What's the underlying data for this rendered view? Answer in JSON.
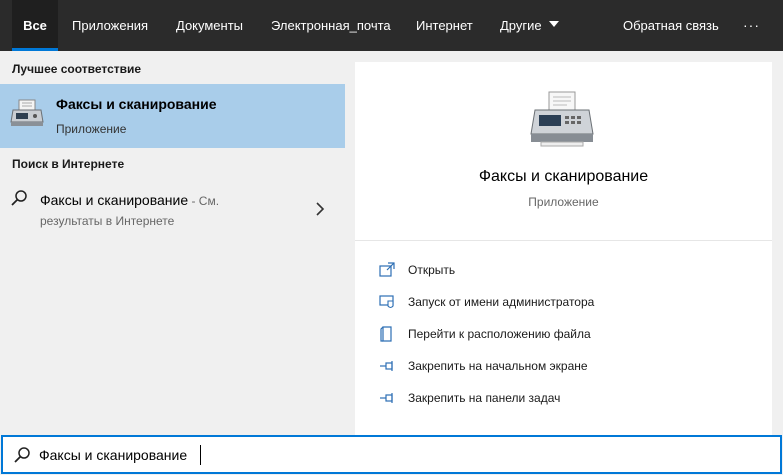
{
  "tabs": [
    {
      "label": "Все",
      "active": true
    },
    {
      "label": "Приложения"
    },
    {
      "label": "Документы"
    },
    {
      "label": "Электронная_почта"
    },
    {
      "label": "Интернет"
    },
    {
      "label": "Другие"
    }
  ],
  "header": {
    "feedback": "Обратная связь",
    "more": "···"
  },
  "left": {
    "best_match_title": "Лучшее соответствие",
    "best_match": {
      "title": "Факсы и сканирование",
      "subtitle": "Приложение",
      "icon": "fax-scanner-icon"
    },
    "web_title": "Поиск в Интернете",
    "web_result": {
      "title": "Факсы и сканирование",
      "suffix": " - См.",
      "subtitle": "результаты в Интернете",
      "icon": "search-icon"
    }
  },
  "preview": {
    "title": "Факсы и сканирование",
    "subtitle": "Приложение",
    "actions": [
      {
        "label": "Открыть",
        "icon": "open-icon"
      },
      {
        "label": "Запуск от имени администратора",
        "icon": "shield-icon"
      },
      {
        "label": "Перейти к расположению файла",
        "icon": "file-location-icon"
      },
      {
        "label": "Закрепить на начальном экране",
        "icon": "pin-icon"
      },
      {
        "label": "Закрепить на панели задач",
        "icon": "pin-icon"
      }
    ]
  },
  "search": {
    "value": "Факсы и сканирование"
  },
  "colors": {
    "accent": "#0078d7",
    "selected": "#a9cdea",
    "topbar": "#2b2b2b"
  }
}
